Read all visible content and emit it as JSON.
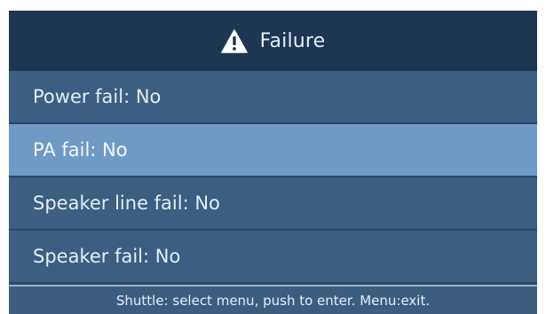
{
  "title": {
    "icon": "warning-icon",
    "text": "Failure"
  },
  "menu": {
    "selected_index": 1,
    "items": [
      {
        "label": "Power fail: No"
      },
      {
        "label": "PA fail: No"
      },
      {
        "label": "Speaker line fail: No"
      },
      {
        "label": "Speaker fail: No"
      }
    ]
  },
  "status": {
    "hint": "Shuttle: select menu, push to enter. Menu:exit."
  },
  "colors": {
    "title_bg": "#1d3651",
    "item_bg": "#3a5f83",
    "selected_bg": "#6f9ac5",
    "text": "#e6edf3"
  }
}
